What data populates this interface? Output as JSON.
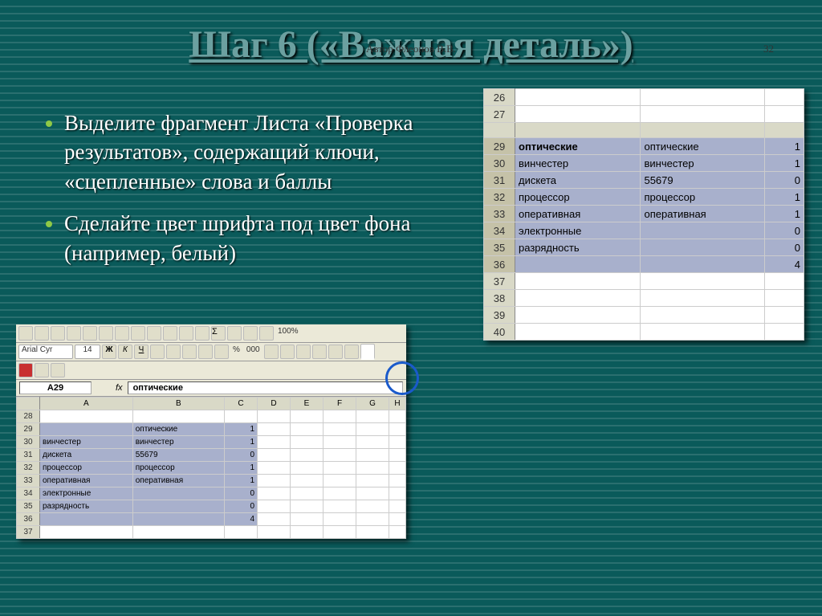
{
  "title": "Шаг 6 («Важная деталь»)",
  "bullets": [
    "Выделите фрагмент Листа «Проверка результатов», содержащий ключи, «сцепленные» слова и баллы",
    "Сделайте цвет шрифта под цвет фона (например, белый)"
  ],
  "footer_author": "Автор Флеонов В.В.",
  "footer_page": "32",
  "right_sheet": {
    "visible_rows_before": [
      26,
      27
    ],
    "visible_rows_after": [
      37,
      38,
      39,
      40
    ],
    "data_rows": [
      {
        "row": 29,
        "a": "оптические",
        "b": "оптические",
        "c": "1"
      },
      {
        "row": 30,
        "a": "винчестер",
        "b": "винчестер",
        "c": "1"
      },
      {
        "row": 31,
        "a": "дискета",
        "b": "55679",
        "c": "0"
      },
      {
        "row": 32,
        "a": "процессор",
        "b": "процессор",
        "c": "1"
      },
      {
        "row": 33,
        "a": "оперативная",
        "b": "оперативная",
        "c": "1"
      },
      {
        "row": 34,
        "a": "электронные",
        "b": "",
        "c": "0"
      },
      {
        "row": 35,
        "a": "разрядность",
        "b": "",
        "c": "0"
      },
      {
        "row": 36,
        "a": "",
        "b": "",
        "c": "4"
      }
    ]
  },
  "excel": {
    "font_name": "Arial Cyr",
    "font_size": "14",
    "zoom": "100%",
    "name_box": "A29",
    "formula_value": "оптические",
    "columns": [
      "A",
      "B",
      "C",
      "D",
      "E",
      "F",
      "G",
      "H"
    ],
    "first_empty_row": 28,
    "data_rows": [
      {
        "row": 29,
        "a": "",
        "b": "оптические",
        "c": "1"
      },
      {
        "row": 30,
        "a": "винчестер",
        "b": "винчестер",
        "c": "1"
      },
      {
        "row": 31,
        "a": "дискета",
        "b": "55679",
        "c": "0"
      },
      {
        "row": 32,
        "a": "процессор",
        "b": "процессор",
        "c": "1"
      },
      {
        "row": 33,
        "a": "оперативная",
        "b": "оперативная",
        "c": "1"
      },
      {
        "row": 34,
        "a": "электронные",
        "b": "",
        "c": "0"
      },
      {
        "row": 35,
        "a": "разрядность",
        "b": "",
        "c": "0"
      },
      {
        "row": 36,
        "a": "",
        "b": "",
        "c": "4"
      }
    ],
    "trailing_empty_row": 37
  }
}
